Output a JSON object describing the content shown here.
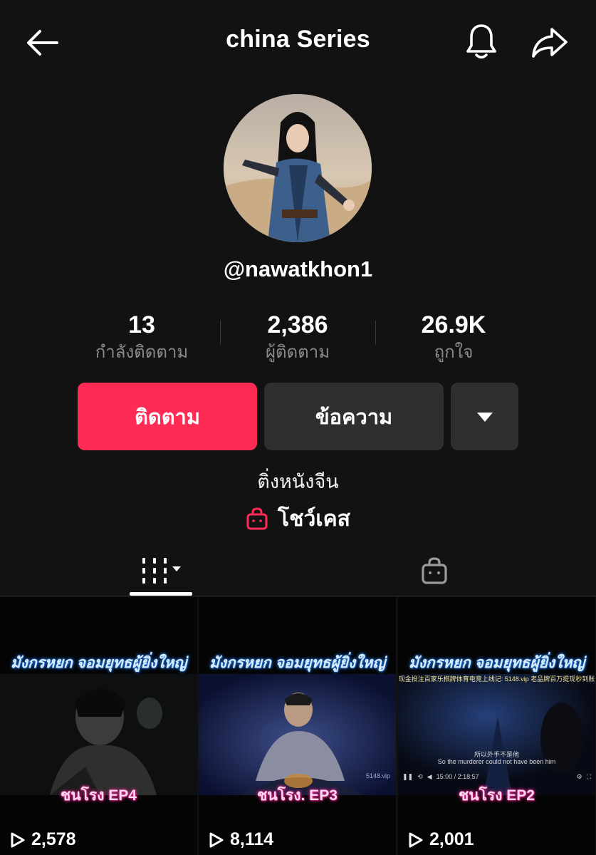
{
  "header": {
    "title": "china Series",
    "icons": {
      "back": "arrow-left-icon",
      "notifications": "bell-icon",
      "share": "share-arrow-icon"
    }
  },
  "profile": {
    "handle": "@nawatkhon1",
    "avatar": "profile-photo"
  },
  "stats": [
    {
      "value": "13",
      "label": "กำลังติดตาม"
    },
    {
      "value": "2,386",
      "label": "ผู้ติดตาม"
    },
    {
      "value": "26.9K",
      "label": "ถูกใจ"
    }
  ],
  "actions": {
    "follow_label": "ติดตาม",
    "message_label": "ข้อความ",
    "more_icon": "caret-down-icon"
  },
  "bio": "ติ่งหนังจีน",
  "showcase": {
    "label": "โชว์เคส",
    "icon": "shopping-bag-icon"
  },
  "tabs": {
    "videos_icon": "grid-columns-icon",
    "shop_icon": "shopping-bag-icon"
  },
  "videos": [
    {
      "caption_top": "มังกรหยก จอมยุทธผู้ยิ่งใหญ่",
      "caption_bottom": "ชนโรง EP4",
      "views": "2,578"
    },
    {
      "caption_top": "มังกรหยก จอมยุทธผู้ยิ่งใหญ่",
      "caption_bottom": "ชนโรง. EP3",
      "views": "8,114",
      "corner_text": "5148.vip"
    },
    {
      "caption_top": "มังกรหยก จอมยุทธผู้ยิ่งใหญ่",
      "caption_bottom": "ชนโรง EP2",
      "views": "2,001",
      "ad_text": "现金投注百家乐棋牌体育电竞上线记: 5148.vip 老品牌百万提现秒到账",
      "subtitle_cn": "所以外手不是他",
      "subtitle_en": "So the murderer could not have been him",
      "player_time": "15:00 / 2:18:57"
    }
  ],
  "colors": {
    "background": "#121212",
    "accent": "#fe2c55",
    "secondary_button": "#2f2f2f",
    "muted_text": "#8a8a8a"
  }
}
